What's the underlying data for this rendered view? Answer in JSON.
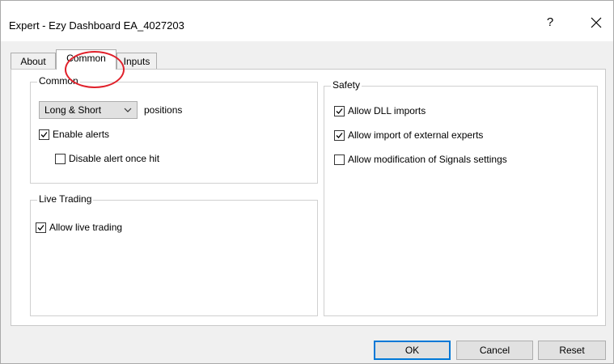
{
  "window": {
    "title": "Expert - Ezy Dashboard EA_4027203",
    "help_label": "?"
  },
  "tabs": [
    {
      "label": "About",
      "active": false
    },
    {
      "label": "Common",
      "active": true
    },
    {
      "label": "Inputs",
      "active": false
    }
  ],
  "common_group": {
    "title": "Common",
    "positions_dropdown": {
      "value": "Long & Short"
    },
    "positions_label": "positions",
    "enable_alerts": {
      "label": "Enable alerts",
      "checked": true
    },
    "disable_alert_once_hit": {
      "label": "Disable alert once hit",
      "checked": false
    }
  },
  "live_trading_group": {
    "title": "Live Trading",
    "allow_live_trading": {
      "label": "Allow live trading",
      "checked": true
    }
  },
  "safety_group": {
    "title": "Safety",
    "allow_dll_imports": {
      "label": "Allow DLL imports",
      "checked": true
    },
    "allow_import_external_experts": {
      "label": "Allow import of external experts",
      "checked": true
    },
    "allow_modification_signals": {
      "label": "Allow modification of Signals settings",
      "checked": false
    }
  },
  "footer": {
    "ok_label": "OK",
    "cancel_label": "Cancel",
    "reset_label": "Reset"
  },
  "colors": {
    "highlight_circle": "#e0202a",
    "dialog_bg": "#f0f0f0",
    "default_button_border": "#0078d7"
  }
}
